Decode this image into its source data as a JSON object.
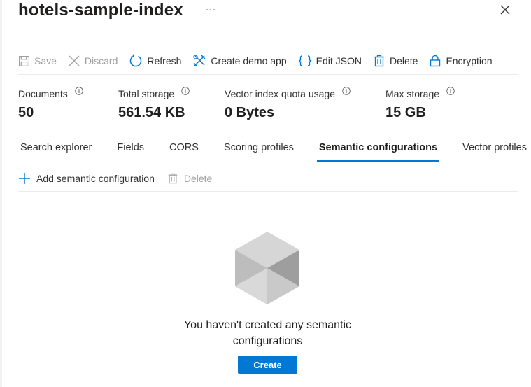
{
  "header": {
    "title": "hotels-sample-index",
    "more_label": "···"
  },
  "toolbar": {
    "save_label": "Save",
    "discard_label": "Discard",
    "refresh_label": "Refresh",
    "create_demo_app_label": "Create demo app",
    "edit_json_label": "Edit JSON",
    "delete_label": "Delete",
    "encryption_label": "Encryption"
  },
  "stats": [
    {
      "label": "Documents",
      "value": "50"
    },
    {
      "label": "Total storage",
      "value": "561.54 KB"
    },
    {
      "label": "Vector index quota usage",
      "value": "0 Bytes"
    },
    {
      "label": "Max storage",
      "value": "15 GB"
    }
  ],
  "tabs": [
    {
      "label": "Search explorer"
    },
    {
      "label": "Fields"
    },
    {
      "label": "CORS"
    },
    {
      "label": "Scoring profiles"
    },
    {
      "label": "Semantic configurations",
      "active": true
    },
    {
      "label": "Vector profiles"
    }
  ],
  "subtoolbar": {
    "add_label": "Add semantic configuration",
    "delete_label": "Delete"
  },
  "empty_state": {
    "message": "You haven't created any semantic configurations",
    "create_label": "Create"
  },
  "colors": {
    "accent": "#0078d4",
    "disabled": "#a19f9d",
    "divider": "#edebe9"
  }
}
